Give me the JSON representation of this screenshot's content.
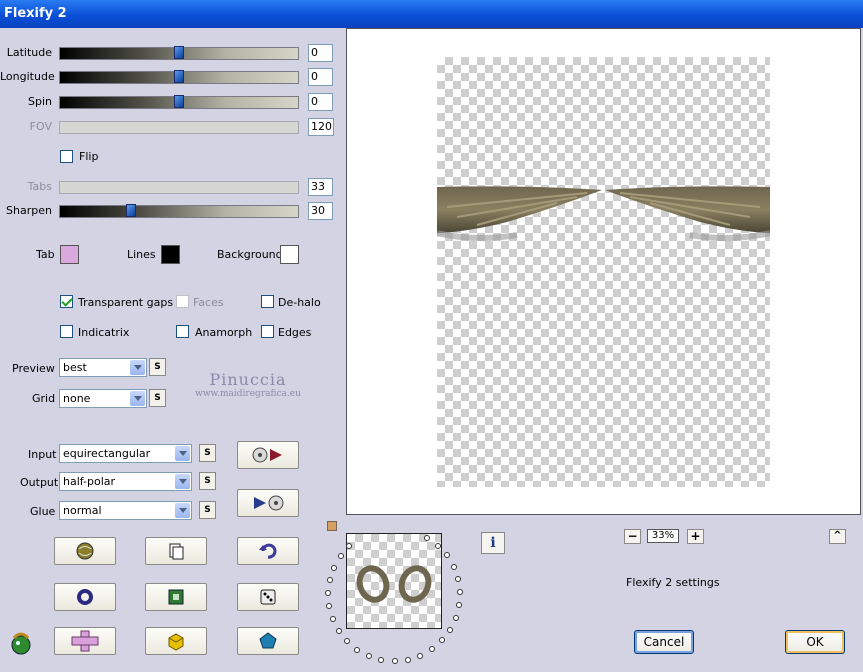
{
  "window": {
    "title": "Flexify 2"
  },
  "sliders": [
    {
      "id": "latitude",
      "label": "Latitude",
      "value": "0",
      "position": 0.5,
      "enabled": true
    },
    {
      "id": "longitude",
      "label": "Longitude",
      "value": "0",
      "position": 0.5,
      "enabled": true
    },
    {
      "id": "spin",
      "label": "Spin",
      "value": "0",
      "position": 0.5,
      "enabled": true
    },
    {
      "id": "fov",
      "label": "FOV",
      "value": "120",
      "position": 0,
      "enabled": false
    },
    {
      "id": "tabs",
      "label": "Tabs",
      "value": "33",
      "position": 0,
      "enabled": false
    },
    {
      "id": "sharpen",
      "label": "Sharpen",
      "value": "30",
      "position": 0.3,
      "enabled": true
    }
  ],
  "flip": {
    "label": "Flip",
    "checked": false
  },
  "colors": {
    "tab": {
      "label": "Tab",
      "color": "#d9a8dc"
    },
    "lines": {
      "label": "Lines",
      "color": "#000000"
    },
    "background": {
      "label": "Background",
      "color": "#ffffff"
    }
  },
  "options": {
    "transparent_gaps": {
      "label": "Transparent gaps",
      "checked": true
    },
    "faces": {
      "label": "Faces",
      "checked": false,
      "enabled": false
    },
    "de_halo": {
      "label": "De-halo",
      "checked": false
    },
    "indicatrix": {
      "label": "Indicatrix",
      "checked": false
    },
    "anamorph": {
      "label": "Anamorph",
      "checked": false
    },
    "edges": {
      "label": "Edges",
      "checked": false
    }
  },
  "preview_select": {
    "label": "Preview",
    "value": "best"
  },
  "grid_select": {
    "label": "Grid",
    "value": "none"
  },
  "input_select": {
    "label": "Input",
    "value": "equirectangular"
  },
  "output_select": {
    "label": "Output",
    "value": "half-polar"
  },
  "glue_select": {
    "label": "Glue",
    "value": "normal"
  },
  "s_button_label": "S",
  "watermark": {
    "line1": "Pinuccia",
    "line2": "www.maidiregrafica.eu"
  },
  "zoom": {
    "value": "33%",
    "minus": "−",
    "plus": "+"
  },
  "status_text": "Flexify 2 settings",
  "collapse_label": "^",
  "info_label": "i",
  "buttons": {
    "cancel": "Cancel",
    "ok": "OK"
  },
  "icon_colors": {
    "shape": "#6f6650",
    "accent": "#3b3b99"
  }
}
